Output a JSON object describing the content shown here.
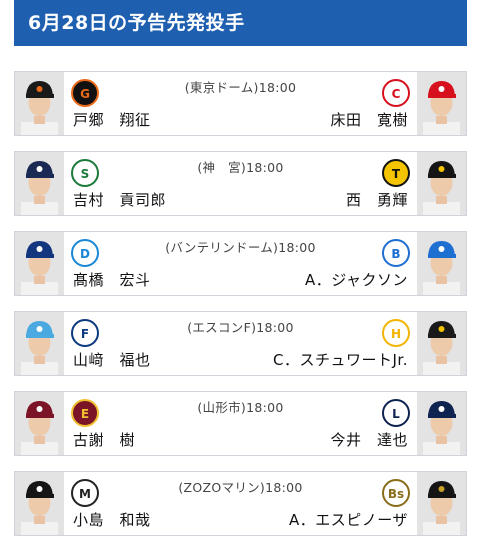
{
  "header": {
    "title": "6月28日の予告先発投手"
  },
  "games": [
    {
      "venue": "(東京ドーム)",
      "time": "18:00",
      "home": {
        "pitcher": "戸郷　翔征",
        "team_logo": "giants-logo",
        "cap_color": "#1a1a1a",
        "cap_mark": "#e86a1a"
      },
      "away": {
        "pitcher": "床田　寛樹",
        "team_logo": "carp-logo",
        "cap_color": "#d7101e",
        "cap_mark": "#ffffff"
      }
    },
    {
      "venue": "(神　宮)",
      "time": "18:00",
      "home": {
        "pitcher": "吉村　貢司郎",
        "team_logo": "swallows-logo",
        "cap_color": "#1b2a55",
        "cap_mark": "#ffffff"
      },
      "away": {
        "pitcher": "西　勇輝",
        "team_logo": "tigers-logo",
        "cap_color": "#141414",
        "cap_mark": "#f4c400"
      }
    },
    {
      "venue": "(バンテリンドーム)",
      "time": "18:00",
      "home": {
        "pitcher": "髙橋　宏斗",
        "team_logo": "dragons-logo",
        "cap_color": "#13367e",
        "cap_mark": "#ffffff"
      },
      "away": {
        "pitcher": "A．ジャクソン",
        "team_logo": "baystars-logo",
        "cap_color": "#1d6fd1",
        "cap_mark": "#ffffff"
      }
    },
    {
      "venue": "(エスコンF)",
      "time": "18:00",
      "home": {
        "pitcher": "山﨑　福也",
        "team_logo": "fighters-logo",
        "cap_color": "#4aa9e0",
        "cap_mark": "#ffffff"
      },
      "away": {
        "pitcher": "C．スチュワートJr.",
        "team_logo": "hawks-logo",
        "cap_color": "#1a1a1a",
        "cap_mark": "#f2c400"
      }
    },
    {
      "venue": "(山形市)",
      "time": "18:00",
      "home": {
        "pitcher": "古謝　樹",
        "team_logo": "eagles-logo",
        "cap_color": "#7a1426",
        "cap_mark": "#ffffff"
      },
      "away": {
        "pitcher": "今井　達也",
        "team_logo": "lions-logo",
        "cap_color": "#0f2350",
        "cap_mark": "#ffffff"
      }
    },
    {
      "venue": "(ZOZOマリン)",
      "time": "18:00",
      "home": {
        "pitcher": "小島　和哉",
        "team_logo": "marines-logo",
        "cap_color": "#151515",
        "cap_mark": "#ffffff"
      },
      "away": {
        "pitcher": "A．エスピノーザ",
        "team_logo": "buffaloes-logo",
        "cap_color": "#151515",
        "cap_mark": "#c9a227"
      }
    }
  ]
}
